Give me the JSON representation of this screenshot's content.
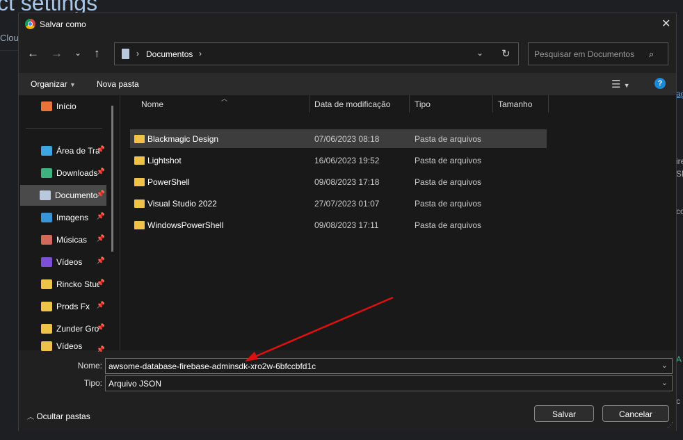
{
  "background": {
    "title": "ct settings",
    "subtitle": "Clou",
    "right_texts": [
      "ag",
      "ire",
      "SD",
      "co",
      "A",
      "c"
    ]
  },
  "dialog": {
    "title": "Salvar como",
    "address": {
      "segments": [
        "Documentos"
      ]
    },
    "search": {
      "placeholder": "Pesquisar em Documentos"
    },
    "toolbar": {
      "organize": "Organizar",
      "new_folder": "Nova pasta",
      "help": "?"
    },
    "sidebar": {
      "items": [
        {
          "label": "Início",
          "icon": "home-icon",
          "color": "#e8743b"
        },
        {
          "label": "Área de Trabalho",
          "icon": "desktop-icon",
          "color": "#3ea6e0",
          "pinned": true
        },
        {
          "label": "Downloads",
          "icon": "download-icon",
          "color": "#3fb37f",
          "pinned": true
        },
        {
          "label": "Documentos",
          "icon": "document-icon",
          "color": "#b9c8dc",
          "pinned": true,
          "selected": true
        },
        {
          "label": "Imagens",
          "icon": "pictures-icon",
          "color": "#3a94d8",
          "pinned": true
        },
        {
          "label": "Músicas",
          "icon": "music-icon",
          "color": "#d16a5a",
          "pinned": true
        },
        {
          "label": "Vídeos",
          "icon": "videos-icon",
          "color": "#7c4fd6",
          "pinned": true
        },
        {
          "label": "Rincko Studio",
          "icon": "cloud-folder-icon",
          "color": "#f0c24a",
          "pinned": true
        },
        {
          "label": "Prods Fx",
          "icon": "cloud-folder-icon",
          "color": "#f0c24a",
          "pinned": true
        },
        {
          "label": "Zunder Group",
          "icon": "cloud-folder-icon",
          "color": "#f0c24a",
          "pinned": true
        },
        {
          "label": "Vídeos",
          "icon": "cloud-folder-icon",
          "color": "#f0c24a",
          "pinned": true
        }
      ]
    },
    "columns": [
      "Nome",
      "Data de modificação",
      "Tipo",
      "Tamanho"
    ],
    "files": [
      {
        "name": "Blackmagic Design",
        "date": "07/06/2023 08:18",
        "type": "Pasta de arquivos",
        "selected": true
      },
      {
        "name": "Lightshot",
        "date": "16/06/2023 19:52",
        "type": "Pasta de arquivos"
      },
      {
        "name": "PowerShell",
        "date": "09/08/2023 17:18",
        "type": "Pasta de arquivos"
      },
      {
        "name": "Visual Studio 2022",
        "date": "27/07/2023 01:07",
        "type": "Pasta de arquivos"
      },
      {
        "name": "WindowsPowerShell",
        "date": "09/08/2023 17:11",
        "type": "Pasta de arquivos"
      }
    ],
    "filename_label": "Nome:",
    "filename": "awsome-database-firebase-adminsdk-xro2w-6bfccbfd1c",
    "filetype_label": "Tipo:",
    "filetype": "Arquivo JSON",
    "hide_folders": "Ocultar pastas",
    "save": "Salvar",
    "cancel": "Cancelar"
  },
  "annotation_color": "#e01010"
}
